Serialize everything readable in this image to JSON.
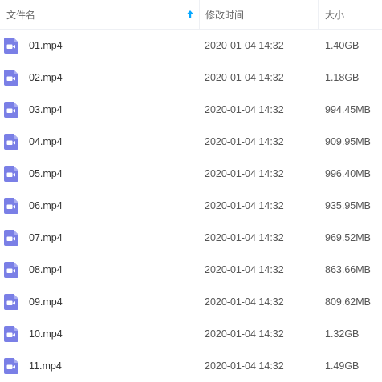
{
  "header": {
    "name_label": "文件名",
    "date_label": "修改时间",
    "size_label": "大小",
    "sort_icon": "arrow-up-icon"
  },
  "colors": {
    "sort_arrow": "#06a7ff",
    "video_icon": "#7a7fe6"
  },
  "files": [
    {
      "name": "01.mp4",
      "modified": "2020-01-04 14:32",
      "size": "1.40GB",
      "icon": "video-file-icon"
    },
    {
      "name": "02.mp4",
      "modified": "2020-01-04 14:32",
      "size": "1.18GB",
      "icon": "video-file-icon"
    },
    {
      "name": "03.mp4",
      "modified": "2020-01-04 14:32",
      "size": "994.45MB",
      "icon": "video-file-icon"
    },
    {
      "name": "04.mp4",
      "modified": "2020-01-04 14:32",
      "size": "909.95MB",
      "icon": "video-file-icon"
    },
    {
      "name": "05.mp4",
      "modified": "2020-01-04 14:32",
      "size": "996.40MB",
      "icon": "video-file-icon"
    },
    {
      "name": "06.mp4",
      "modified": "2020-01-04 14:32",
      "size": "935.95MB",
      "icon": "video-file-icon"
    },
    {
      "name": "07.mp4",
      "modified": "2020-01-04 14:32",
      "size": "969.52MB",
      "icon": "video-file-icon"
    },
    {
      "name": "08.mp4",
      "modified": "2020-01-04 14:32",
      "size": "863.66MB",
      "icon": "video-file-icon"
    },
    {
      "name": "09.mp4",
      "modified": "2020-01-04 14:32",
      "size": "809.62MB",
      "icon": "video-file-icon"
    },
    {
      "name": "10.mp4",
      "modified": "2020-01-04 14:32",
      "size": "1.32GB",
      "icon": "video-file-icon"
    },
    {
      "name": "11.mp4",
      "modified": "2020-01-04 14:32",
      "size": "1.49GB",
      "icon": "video-file-icon"
    }
  ]
}
